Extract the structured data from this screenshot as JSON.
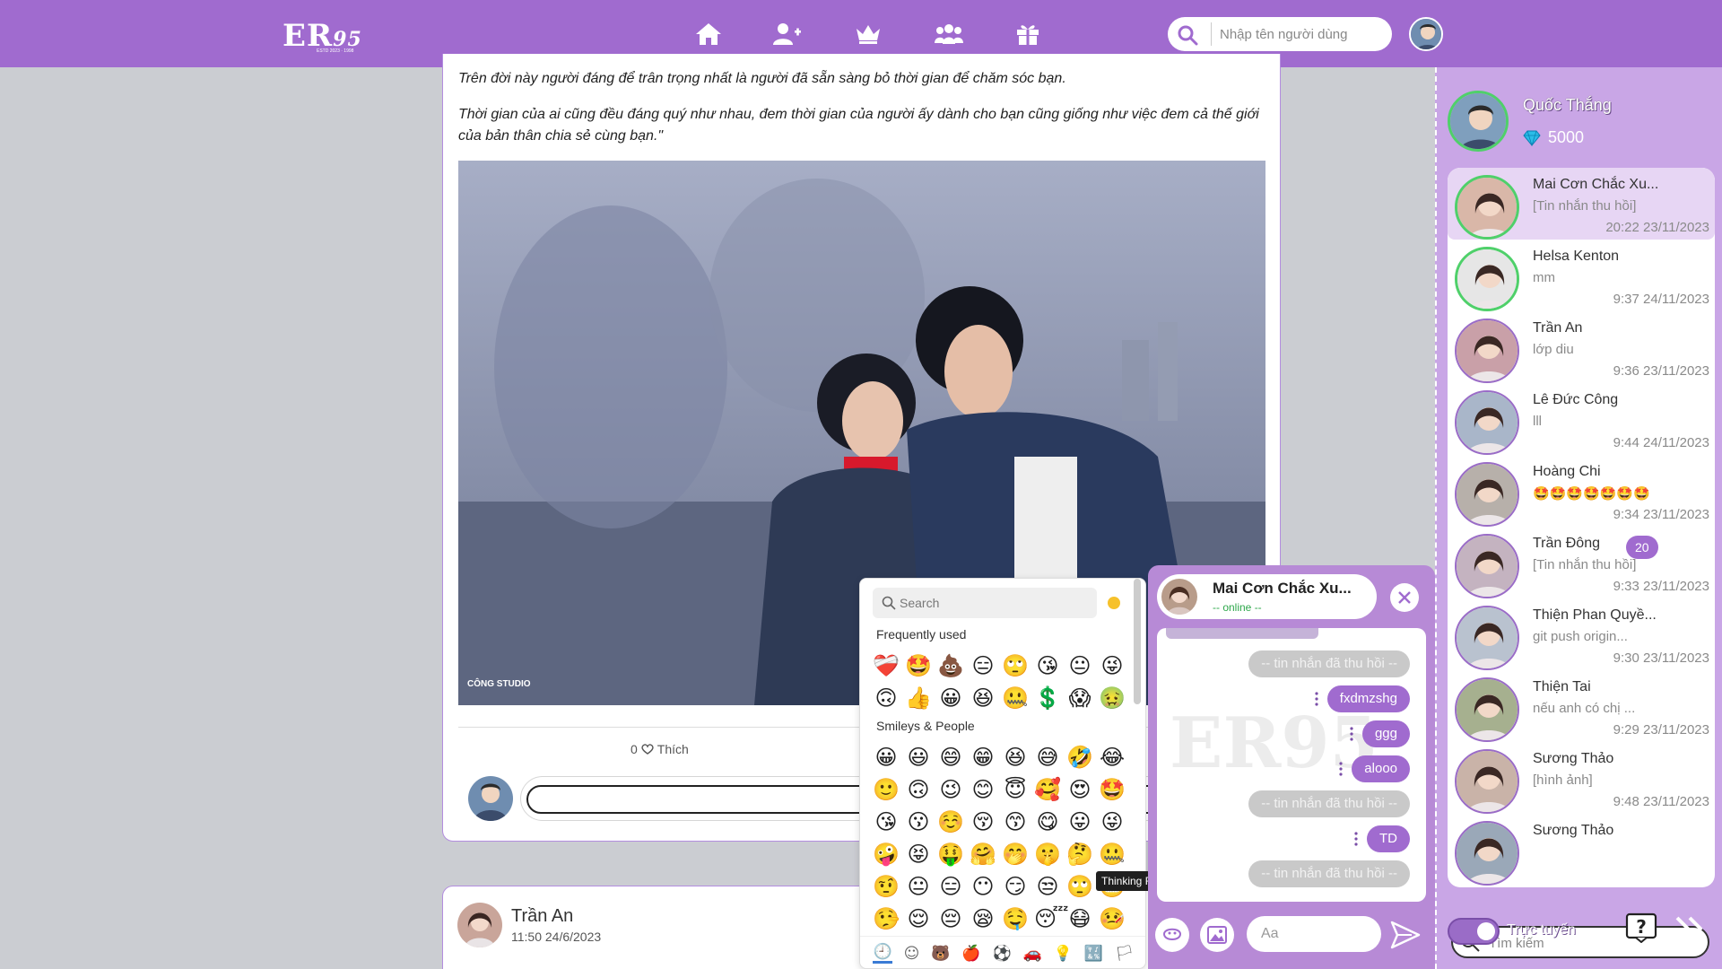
{
  "header": {
    "logo_text": "ER",
    "logo_number": "95",
    "logo_subtitle": "ESTD 2023 · 1998",
    "search_placeholder": "Nhập tên người dùng",
    "nav": [
      "home-icon",
      "add-friend-icon",
      "crown-icon",
      "group-icon",
      "gift-icon"
    ]
  },
  "post": {
    "paragraph1": "Trên đời này người đáng để trân trọng nhất là người đã sẵn sàng bỏ thời gian để chăm sóc bạn.",
    "paragraph2": "Thời gian của ai cũng đều đáng quý như nhau, đem thời gian của người ấy dành cho bạn cũng giống như việc đem cả thế giới của bản thân chia sẻ cùng bạn.\"",
    "photo_watermark": "CÔNG STUDIO",
    "like_count": "0",
    "like_label": "Thích"
  },
  "next_post": {
    "author": "Trần An",
    "time": "11:50 24/6/2023"
  },
  "emoji_picker": {
    "search_placeholder": "Search",
    "section_frequent": "Frequently used",
    "frequent_rows": [
      [
        "❤️‍🩹",
        "🤩",
        "💩",
        "😑",
        "🙄",
        "😘",
        "😐",
        "😜"
      ],
      [
        "🙃",
        "👍",
        "😀",
        "😆",
        "🤐",
        "💲",
        "😱",
        "🤢"
      ]
    ],
    "section_smileys": "Smileys & People",
    "smiley_rows": [
      [
        "😀",
        "😃",
        "😄",
        "😁",
        "😆",
        "😅",
        "🤣",
        "😂"
      ],
      [
        "🙂",
        "🙃",
        "😉",
        "😊",
        "😇",
        "🥰",
        "😍",
        "🤩"
      ],
      [
        "😘",
        "😗",
        "☺️",
        "😚",
        "😙",
        "😋",
        "😛",
        "😜"
      ],
      [
        "🤪",
        "😝",
        "🤑",
        "🤗",
        "🤭",
        "🤫",
        "🤔",
        "🤐"
      ],
      [
        "🤨",
        "😐",
        "😑",
        "😶",
        "😏",
        "😒",
        "🙄",
        "😬"
      ],
      [
        "🤥",
        "😌",
        "😔",
        "😪",
        "🤤",
        "😴",
        "😷",
        "🤒"
      ]
    ],
    "tooltip": "Thinking Face",
    "categories": [
      "🕘",
      "☺",
      "🐻",
      "🍎",
      "⚽",
      "🚗",
      "💡",
      "🔣",
      "🏳"
    ]
  },
  "chat": {
    "name": "Mai Cơn Chắc Xu...",
    "status": "-- online --",
    "messages": [
      {
        "type": "recalled",
        "text": "-- tin nhắn đã thu hồi --"
      },
      {
        "type": "mine",
        "text": "fxdmzshg"
      },
      {
        "type": "mine",
        "text": "ggg"
      },
      {
        "type": "mine",
        "text": "alooo"
      },
      {
        "type": "recalled",
        "text": "-- tin nhắn đã thu hồi --"
      },
      {
        "type": "mine",
        "text": "TD"
      },
      {
        "type": "recalled",
        "text": "-- tin nhắn đã thu hồi --"
      }
    ],
    "input_placeholder": "Aa"
  },
  "sidebar": {
    "me": {
      "name": "Quốc Thắng",
      "coins": "5000"
    },
    "conversations": [
      {
        "name": "Mai Cơn Chắc Xu...",
        "preview": "[Tin nhắn thu hồi]",
        "time": "20:22 23/11/2023",
        "active": true,
        "online": true,
        "badge": ""
      },
      {
        "name": "Helsa Kenton",
        "preview": "mm",
        "time": "9:37 24/11/2023",
        "active": false,
        "online": true,
        "badge": ""
      },
      {
        "name": "Trần An",
        "preview": "lớp diu",
        "time": "9:36 23/11/2023",
        "active": false,
        "online": false,
        "badge": ""
      },
      {
        "name": "Lê Đức Công",
        "preview": "lll",
        "time": "9:44 24/11/2023",
        "active": false,
        "online": false,
        "badge": ""
      },
      {
        "name": "Hoàng Chi",
        "preview": "🤩🤩🤩🤩🤩🤩🤩",
        "time": "9:34 23/11/2023",
        "active": false,
        "online": false,
        "badge": ""
      },
      {
        "name": "Trần Đông",
        "preview": "[Tin nhắn thu hồi]",
        "time": "9:33 23/11/2023",
        "active": false,
        "online": false,
        "badge": "20"
      },
      {
        "name": "Thiện Phan Quyề...",
        "preview": "git push origin...",
        "time": "9:30 23/11/2023",
        "active": false,
        "online": false,
        "badge": ""
      },
      {
        "name": "Thiện Tai",
        "preview": "nếu anh có chị ...",
        "time": "9:29 23/11/2023",
        "active": false,
        "online": false,
        "badge": ""
      },
      {
        "name": "Sương Thảo",
        "preview": "[hình ảnh]",
        "time": "9:48 23/11/2023",
        "active": false,
        "online": false,
        "badge": ""
      },
      {
        "name": "Sương Thảo",
        "preview": "",
        "time": "",
        "active": false,
        "online": false,
        "badge": ""
      }
    ],
    "search_placeholder": "Tìm kiếm",
    "status_label": "Trực tuyến"
  },
  "colors": {
    "primary": "#a06bcf",
    "sidebar_bg": "#c9a6e6",
    "online": "#4fd06a",
    "page_bg": "#cbcdd2"
  }
}
